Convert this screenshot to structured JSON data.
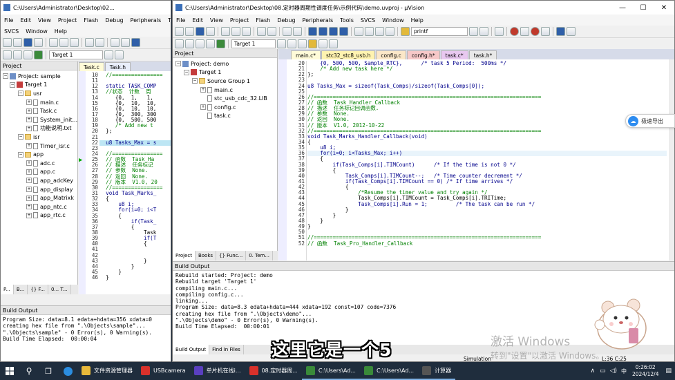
{
  "left_window": {
    "title": "C:\\Users\\Administrator\\Desktop\\02...",
    "menu": [
      "File",
      "Edit",
      "View",
      "Project",
      "Flash",
      "Debug",
      "Peripherals",
      "Tools"
    ],
    "menu2": [
      "SVCS",
      "Window",
      "Help"
    ],
    "target": "Target 1",
    "project_pane_title": "Project",
    "tree": {
      "root": "Project: sample",
      "target": "Target 1",
      "groups": [
        {
          "name": "usr",
          "files": [
            "main.c",
            "Task.c",
            "System_init...",
            "功能说明.txt"
          ]
        },
        {
          "name": "isr",
          "files": [
            "Timer_isr.c"
          ]
        },
        {
          "name": "app",
          "files": [
            "adc.c",
            "app.c",
            "app_adcKey",
            "app_display",
            "app_Matrixk",
            "app_ntc.c",
            "app_rtc.c"
          ]
        }
      ]
    },
    "bottom_tabs": [
      "P...",
      "B...",
      "{} F...",
      "0... T..."
    ],
    "editor_tabs": [
      "Task.c",
      "Task.h"
    ],
    "line_numbers": [
      "10",
      "11",
      "12",
      "13",
      "14",
      "15",
      "16",
      "17",
      "18",
      "19",
      "20",
      "21",
      "22",
      "23",
      "24",
      "25",
      "26",
      "27",
      "28",
      "29",
      "30",
      "31",
      "32",
      "33",
      "34",
      "35",
      "36",
      "37",
      "38",
      "39",
      "40",
      "41",
      "42",
      "43",
      "44",
      "45",
      "46"
    ],
    "code": [
      "  //================",
      "",
      "  static TASK_COMP",
      "  //状态  计数  周",
      "     {0,  1,   1,",
      "     {0,  10,  10,",
      "     {0,  10,  10,",
      "     {0,  300, 300",
      "     {0,  500, 500",
      "     /* Add new t",
      "  };",
      "",
      "  u8 Tasks_Max = s",
      "",
      "  //================",
      "  // 函数  Task_Ha",
      "  // 描述  任务标记",
      "  // 参数  None.",
      "  // 返回  None.",
      "  // 版本  V1.0, 20",
      "  //================",
      "  void Task_Marks_",
      "  {",
      "      u8 i;",
      "      for(i=0; i<T",
      "      {",
      "          if(Task_",
      "          {",
      "              Task",
      "              if(T",
      "              {",
      "",
      "",
      "              }",
      "          }",
      "      }",
      "  }"
    ],
    "build_output_title": "Build Output",
    "build_output": [
      "Program Size: data=8.1 edata+hdata=356 xdata=0",
      "creating hex file from \".\\Objects\\sample\"...",
      "\".\\Objects\\sample\" - 0 Error(s), 0 Warning(s).",
      "Build Time Elapsed:  00:00:04"
    ]
  },
  "main_window": {
    "title": "C:\\Users\\Administrator\\Desktop\\08.定时器周期性调度任务\\示例代码\\demo.uvproj - µVision",
    "menu": [
      "File",
      "Edit",
      "View",
      "Project",
      "Flash",
      "Debug",
      "Peripherals",
      "Tools",
      "SVCS",
      "Window",
      "Help"
    ],
    "toolbar_find": "printf",
    "target": "Target 1",
    "project_pane_title": "Project",
    "tree": {
      "root": "Project: demo",
      "target": "Target 1",
      "group": "Source Group 1",
      "files": [
        "main.c",
        "stc_usb_cdc_32.LIB",
        "config.c",
        "task.c"
      ]
    },
    "bottom_tabs": [
      "Project",
      "Books",
      "{} Func...",
      "0. Tem..."
    ],
    "editor_tabs": [
      "main.c*",
      "stc32_stc8_usb.h",
      "config.c",
      "config.h*",
      "task.c*",
      "task.h*"
    ],
    "line_numbers": [
      "20",
      "21",
      "22",
      "23",
      "24",
      "25",
      "26",
      "27",
      "28",
      "29",
      "30",
      "31",
      "32",
      "33",
      "34",
      "35",
      "36",
      "37",
      "38",
      "39",
      "40",
      "41",
      "42",
      "43",
      "44",
      "45",
      "46",
      "47",
      "48",
      "49",
      "50",
      "51",
      "52"
    ],
    "code": [
      "    {0, 500, 500, Sample_RTC},      /* task 5 Period:  500ms */",
      "    /* Add new task here */",
      "};",
      "",
      "u8 Tasks_Max = sizeof(Task_Comps)/sizeof(Task_Comps[0]);",
      "",
      "//========================================================================",
      "// 函数  Task_Handler_Callback",
      "// 描述  任务标记回调函数.",
      "// 参数  None.",
      "// 返回  None.",
      "// 版本  V1.0, 2012-10-22",
      "//========================================================================",
      "void Task_Marks_Handler_Callback(void)",
      "{",
      "    u8 i;",
      "    for(i=0; i<Tasks_Max; i++)",
      "    {",
      "        if(Task_Comps[i].TIMCount)      /* If the time is not 0 */",
      "        {",
      "            Task_Comps[i].TIMCount--;   /* Time counter decrement */",
      "            if(Task_Comps[i].TIMCount == 0) /* If time arrives */",
      "            {",
      "                /*Resume the timer value and try again */",
      "                Task_Comps[i].TIMCount = Task_Comps[i].TRITime;",
      "                Task_Comps[i].Run = 1;         /* The task can be run */",
      "            }",
      "        }",
      "    }",
      "}",
      "",
      "//========================================================================",
      "// 函数  Task_Pro_Handler_Callback"
    ],
    "build_output_title": "Build Output",
    "build_output": [
      "Rebuild started: Project: demo",
      "Rebuild target 'Target 1'",
      "compiling main.c...",
      "compiling config.c...",
      "linking...",
      "Program Size: data=8.3 edata+hdata=444 xdata=192 const=107 code=7376",
      "creating hex file from \".\\Objects\\demo\"...",
      "\".\\Objects\\demo\" - 0 Error(s), 0 Warning(s).",
      "Build Time Elapsed:  00:00:01"
    ],
    "output_tabs": [
      "Build Output",
      "Find In Files"
    ],
    "status": {
      "mode": "Simulation",
      "position": "L:36 C:25"
    }
  },
  "side_widget": "极速导出",
  "subtitle": "这里它是一个5",
  "watermark": {
    "line1": "激活 Windows",
    "line2": "转到\"设置\"以激活 Windows。"
  },
  "taskbar": {
    "items": [
      {
        "label": "文件资源管理器",
        "color": "#e8b93a"
      },
      {
        "label": "USBcamera",
        "color": "#d9312b"
      },
      {
        "label": "单片机在线i...",
        "color": "#5a3fc0"
      },
      {
        "label": "08.定时器周...",
        "color": "#d9312b"
      },
      {
        "label": "C:\\Users\\Ad...",
        "color": "#3a8a3a"
      },
      {
        "label": "C:\\Users\\Ad...",
        "color": "#3a8a3a"
      },
      {
        "label": "计算器",
        "color": "#555555"
      }
    ],
    "time": "0:26:02",
    "date": "2024/12/4",
    "lang": "中"
  }
}
